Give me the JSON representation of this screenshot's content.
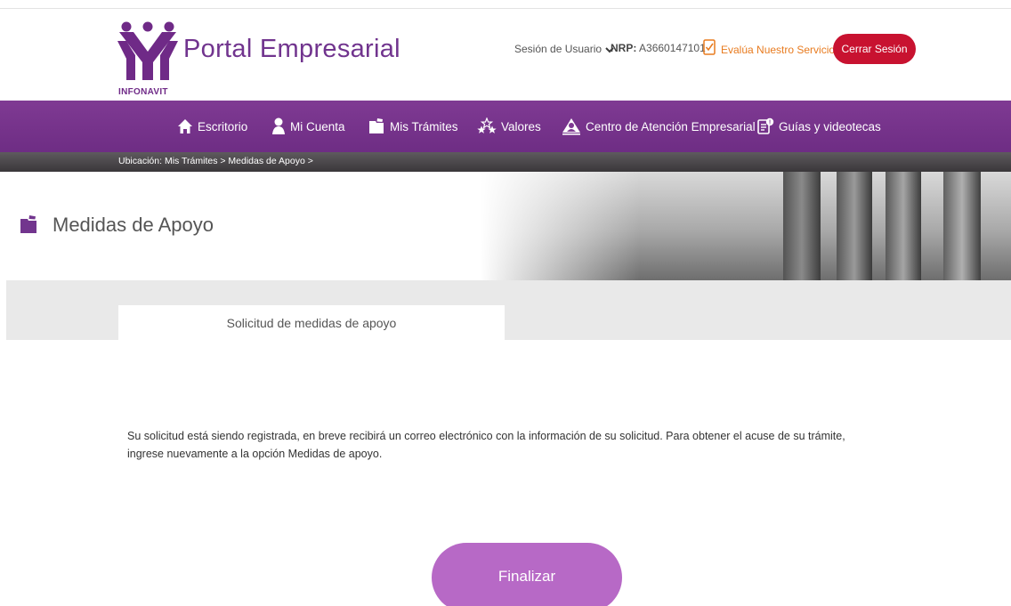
{
  "header": {
    "logo_text": "INFONAVIT",
    "brand_title": "Portal Empresarial",
    "session_label": "Sesión de Usuario",
    "nrp_label": "NRP:",
    "nrp_value": "A3660147101",
    "survey_label": "Evalúa Nuestro Servicio",
    "logout_label": "Cerrar Sesión"
  },
  "nav": {
    "items": [
      {
        "label": "Escritorio",
        "icon": "home-icon"
      },
      {
        "label": "Mi Cuenta",
        "icon": "user-icon"
      },
      {
        "label": "Mis Trámites",
        "icon": "folder-icon"
      },
      {
        "label": "Valores",
        "icon": "stars-icon"
      },
      {
        "label": "Centro de Atención Empresarial",
        "icon": "support-icon"
      },
      {
        "label": "Guías y videotecas",
        "icon": "guide-icon"
      }
    ]
  },
  "breadcrumb": "Ubicación: Mis Trámites > Medidas de Apoyo >",
  "page": {
    "title": "Medidas de Apoyo"
  },
  "tabs": [
    {
      "label": "Solicitud de medidas de apoyo",
      "active": true
    }
  ],
  "content": {
    "message": "Su solicitud está siendo registrada, en breve recibirá un correo electrónico con la información de su solicitud. Para obtener el acuse de su trámite, ingrese nuevamente a la opción Medidas de apoyo.",
    "finish_label": "Finalizar"
  },
  "colors": {
    "brand_purple": "#71348e",
    "nav_purple": "#7f3a93",
    "logout_red": "#c81230",
    "survey_orange": "#e87b1f",
    "finish_button": "#b769c6"
  }
}
